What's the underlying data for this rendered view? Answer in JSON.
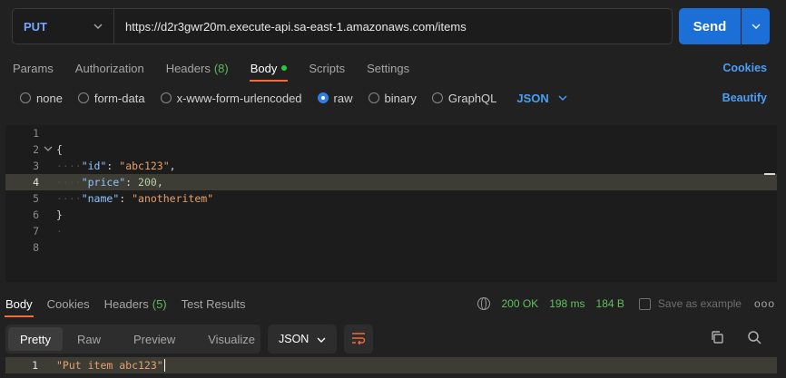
{
  "request": {
    "method": "PUT",
    "url": "https://d2r3gwr20m.execute-api.sa-east-1.amazonaws.com/items",
    "send_label": "Send"
  },
  "request_tabs": {
    "params": "Params",
    "authorization": "Authorization",
    "headers": "Headers",
    "headers_count": "(8)",
    "body": "Body",
    "scripts": "Scripts",
    "settings": "Settings",
    "cookies": "Cookies"
  },
  "body_modes": {
    "none": "none",
    "form_data": "form-data",
    "urlencoded": "x-www-form-urlencoded",
    "raw": "raw",
    "binary": "binary",
    "graphql": "GraphQL",
    "raw_type": "JSON",
    "beautify": "Beautify",
    "selected": "raw"
  },
  "editor": {
    "line_numbers": [
      "1",
      "2",
      "3",
      "4",
      "5",
      "6",
      "7",
      "8"
    ],
    "open_brace": "{",
    "close_brace": "}",
    "key_id": "\"id\"",
    "val_id": "\"abc123\"",
    "key_price": "\"price\"",
    "val_price": "200",
    "key_name": "\"name\"",
    "val_name": "\"anotheritem\"",
    "highlighted_line": 4
  },
  "response": {
    "tabs": {
      "body": "Body",
      "cookies": "Cookies",
      "headers": "Headers",
      "headers_count": "(5)",
      "test_results": "Test Results"
    },
    "status": "200 OK",
    "time": "198 ms",
    "size": "184 B",
    "save_example": "Save as example",
    "more": "ooo",
    "views": {
      "pretty": "Pretty",
      "raw": "Raw",
      "preview": "Preview",
      "visualize": "Visualize"
    },
    "format": "JSON",
    "line_number": "1",
    "body_text": "\"Put item abc123\""
  },
  "colors": {
    "accent": "#1b6fd6",
    "link": "#4b9ef5",
    "method": "#75a7ff",
    "success": "#5fc05f",
    "active_tab_underline": "#f26b3a"
  },
  "icons": {
    "method_dropdown": "chevron-down-icon",
    "send_dropdown": "chevron-down-icon",
    "network": "globe-icon",
    "save": "save-icon",
    "wrap": "wrap-lines-icon",
    "copy": "copy-icon",
    "search": "search-icon"
  }
}
